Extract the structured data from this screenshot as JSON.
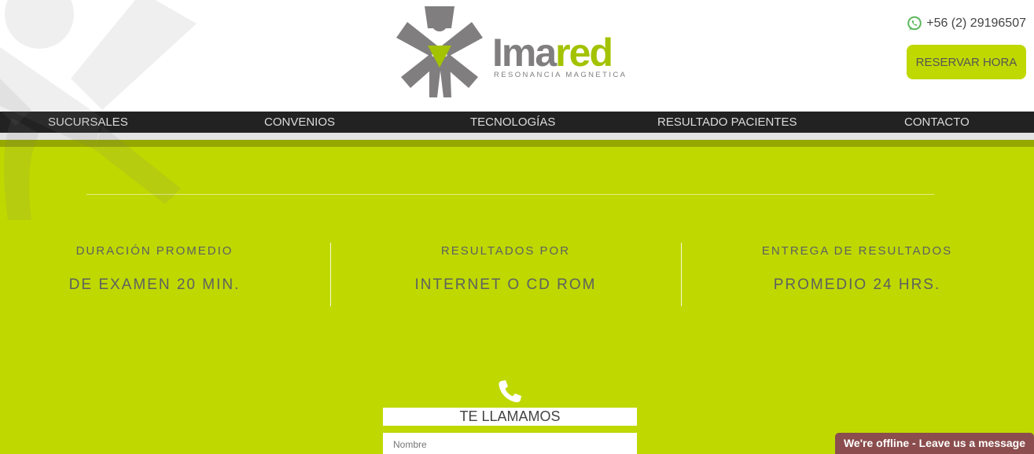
{
  "header": {
    "logo": {
      "word_part1": "Ima",
      "word_part2": "red",
      "tagline": "RESONANCIA MAGNETICA",
      "icon": "imared-figure-logo-icon"
    },
    "phone": {
      "icon": "whatsapp-icon",
      "number": "+56 (2) 29196507"
    },
    "reserve_button": "RESERVAR HORA"
  },
  "nav": {
    "items": [
      {
        "label": "SUCURSALES"
      },
      {
        "label": "CONVENIOS"
      },
      {
        "label": "TECNOLOGÍAS"
      },
      {
        "label": "RESULTADO PACIENTES"
      },
      {
        "label": "CONTACTO"
      }
    ]
  },
  "stats": [
    {
      "top": "DURACIÓN PROMEDIO",
      "bottom": "DE EXAMEN 20 MIN."
    },
    {
      "top": "RESULTADOS POR",
      "bottom": "INTERNET O CD ROM"
    },
    {
      "top": "ENTREGA DE RESULTADOS",
      "bottom": "PROMEDIO 24 HRS."
    }
  ],
  "callback_form": {
    "icon": "phone-icon",
    "title": "TE LLAMAMOS",
    "name_placeholder": "Nombre"
  },
  "chat": {
    "label": "We're offline - Leave us a message"
  },
  "colors": {
    "accent": "#bfd800",
    "nav_bg": "#222222",
    "logo_grey": "#807e7e",
    "logo_green": "#a3c200",
    "chat_bg": "#8b4d4d"
  }
}
